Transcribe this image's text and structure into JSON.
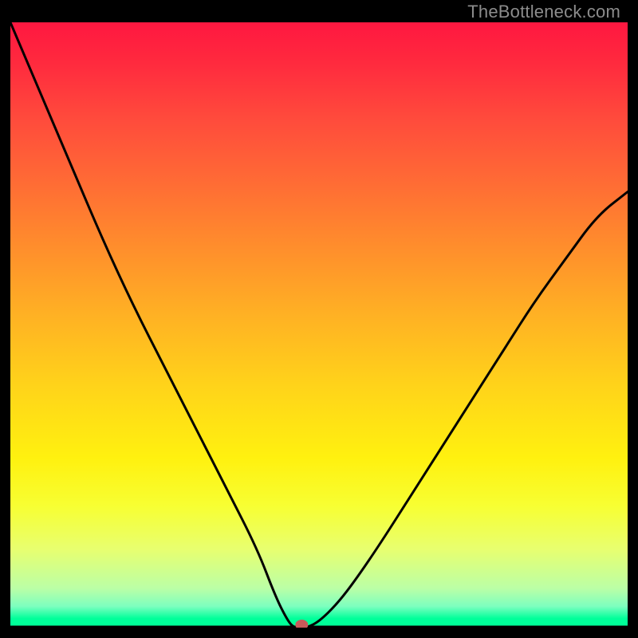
{
  "watermark": "TheBottleneck.com",
  "chart_data": {
    "type": "line",
    "title": "",
    "xlabel": "",
    "ylabel": "",
    "xlim": [
      0,
      100
    ],
    "ylim": [
      0,
      100
    ],
    "series": [
      {
        "name": "bottleneck-curve",
        "x": [
          0,
          5,
          10,
          15,
          20,
          25,
          30,
          35,
          40,
          43,
          45,
          46,
          47,
          48,
          50,
          53,
          56,
          60,
          65,
          70,
          75,
          80,
          85,
          90,
          95,
          100
        ],
        "y": [
          100,
          88,
          76,
          64,
          53,
          43,
          33,
          23,
          13,
          5,
          1,
          0,
          0,
          0,
          1,
          4,
          8,
          14,
          22,
          30,
          38,
          46,
          54,
          61,
          68,
          72
        ]
      }
    ],
    "marker": {
      "x": 47.2,
      "y": 0.2
    },
    "gradient": {
      "colors": [
        "#ff1740",
        "#ff4b3c",
        "#ff8a2d",
        "#ffd31a",
        "#fff10f",
        "#e8ff6f",
        "#7cffbf",
        "#00ff97"
      ],
      "direction": "top-to-bottom"
    }
  }
}
